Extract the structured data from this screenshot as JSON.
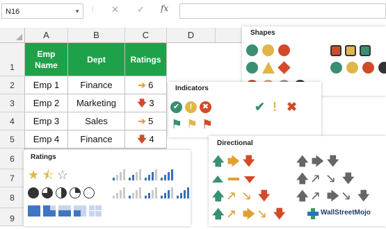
{
  "formula_bar": {
    "name_box": "N16",
    "fx_label": "fx",
    "cancel_glyph": "✕",
    "enter_glyph": "✓",
    "formula_value": ""
  },
  "columns": [
    "A",
    "B",
    "C",
    "D"
  ],
  "rows": [
    "1",
    "2",
    "3",
    "4",
    "5",
    "6",
    "7",
    "8",
    "9"
  ],
  "table": {
    "headers": {
      "emp_name": "Emp\nName",
      "dept": "Dept",
      "ratings": "Ratings"
    },
    "rows": [
      {
        "emp": "Emp 1",
        "dept": "Finance",
        "rating": "6",
        "icon": "yellow-right-arrow"
      },
      {
        "emp": "Emp 2",
        "dept": "Marketing",
        "rating": "3",
        "icon": "red-down-arrow"
      },
      {
        "emp": "Emp 3",
        "dept": "Sales",
        "rating": "5",
        "icon": "yellow-right-arrow"
      },
      {
        "emp": "Emp 4",
        "dept": "Finance",
        "rating": "4",
        "icon": "red-down-arrow"
      }
    ],
    "header_color": "#1fa14a"
  },
  "panels": {
    "shapes": {
      "title": "Shapes"
    },
    "indicators": {
      "title": "Indicators"
    },
    "directional": {
      "title": "Directional"
    },
    "ratings": {
      "title": "Ratings"
    }
  },
  "colors": {
    "green": "#3c8c63",
    "teal": "#3a8f73",
    "yellow": "#e0b54a",
    "red": "#d34a2a",
    "pink": "#e89b8c",
    "gray": "#9a9a9a",
    "dark": "#3a3a3a",
    "blue": "#3b6fb6"
  },
  "watermark": {
    "text": "WallStreetMojo"
  }
}
